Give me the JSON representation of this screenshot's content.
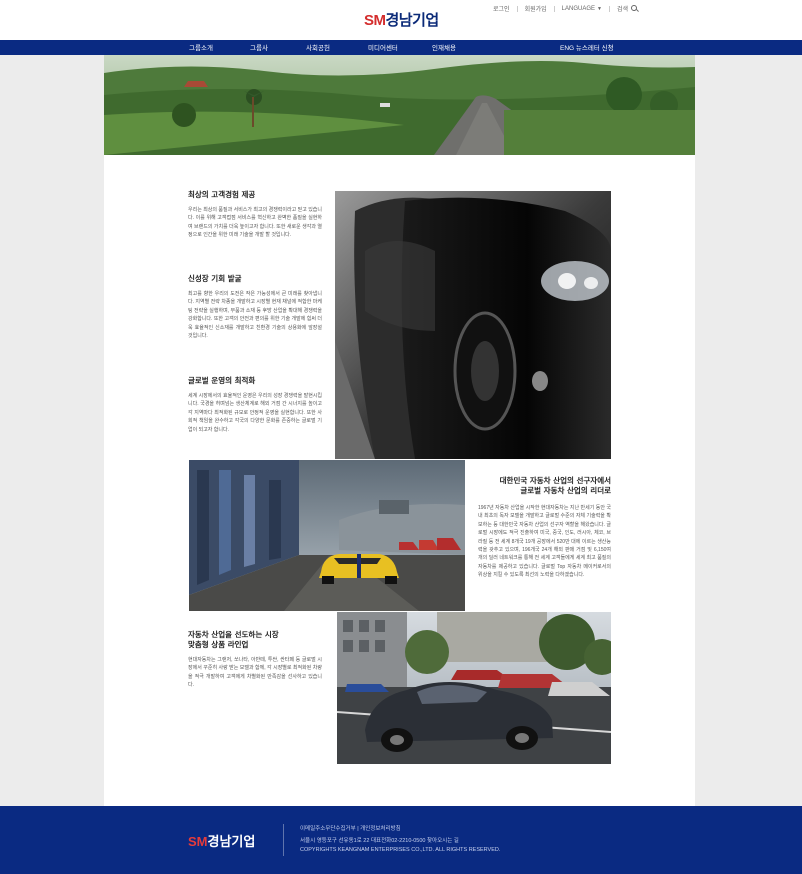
{
  "header": {
    "logo_sm": "SM",
    "logo_name": "경남기업",
    "util": {
      "login": "로그인",
      "join": "회원가입",
      "language": "LANGUAGE",
      "search": "검색"
    }
  },
  "nav": {
    "items": [
      "그룹소개",
      "그룹사",
      "사회공헌",
      "미디어센터",
      "인재채용"
    ],
    "right": "ENG  뉴스레터 신청"
  },
  "sections": [
    {
      "title": "최상의 고객경험 제공",
      "body": "우리는 최상의 품질과 서비스가 최고의 경쟁력이라고 믿고 있습니다. 이를 위해 고객접점 서비스를 혁신하고 완벽한 품질을 실현하여 브랜드의 가치를 더욱 높이고자 합니다. 또한 새로운 생각과 열정으로 인간을 위한 미래 기술을 개발 할 것입니다."
    },
    {
      "title": "신성장 기회 발굴",
      "body": "최고를 향한 우리의 도전은 작은 가능성에서 큰 미래를 찾아냅니다. 지역별 전략 차종을 개발하고 시장별 현재 채널에 적합한 마케팅 전략을 실행하며, 부품과 소재 등 후방 산업을 확대해 경쟁력을 강화합니다. 또한 고객의 안전과 편의를 위한 기술 개발에 힘써 더욱 효율적인 신소재를 개발하고 친환경 기술의 상용화에 앞장설 것입니다."
    },
    {
      "title": "글로벌 운영의 최적화",
      "body": "세계 시장에서의 효율적인 운영은 우리의 성장 경쟁력을 발현시킵니다. 국경을 허며넘는 생산체계로 해외 거점 간 시너지를 높이고 각 지역마다 최적화된 규모로 안정적 운영을 실현합니다. 또한 사회적 책임을 완수하고 각국의 다양한 문화를 존중하는 글로벌 기업이 되고자 합니다."
    },
    {
      "title_line1": "대한민국 자동차 산업의 선구자에서",
      "title_line2": "글로벌 자동차 산업의 리더로",
      "body": "1967년 자동차 산업을 시작한 현대자동차는 지난 반세기 동안 국내 최초의 독자 모델을 개발하고 글로벌 수준의 자체 기술력을 확보하는 등 대한민국 자동차 산업의 선구자 역할을 해왔습니다. 글로벌 시장에도 적극 진출하여 미국, 중국, 인도, 러시아, 체코, 브라질 등 전 세계 8개국 19개 공장에서 520만 대에 이르는 생산능력을 갖추고 있으며, 196개국 24개 해외 판매 거점 및 6,150여 개의 딜러 네트워크를 통해 전 세계 고객들에게 세계 최고 품질의 자동차를 제공하고 있습니다. 글로벌 Top 자동차 메이커로서의 위상을 지킬 수 있도록 최선의 노력을 다하겠습니다."
    },
    {
      "title_line1": "자동차 산업을 선도하는 시장",
      "title_line2": "맞춤형 상품 라인업",
      "body": "현대자동차는 그랜저, 쏘나타, 아반떼, 투싼, 싼타페 등 글로벌 시장에서 꾸준히 사랑 받는 모델과 함께, 각 시장별로 최적화된 차량을 적극 개발하여 고객에게 차별화된 만족감을 선사하고 있습니다."
    }
  ],
  "footer": {
    "logo_sm": "SM",
    "logo_name": "경남기업",
    "links": "이메일주소무단수집거부 | 개인정보처리방침",
    "address": "서울시 영등포구 선유동1로 22     대표전화02-2210-0500  찾아오시는 길",
    "copyright": "COPYRIGHTS KEANGNAM  ENTERPRISES CO.,LTD. ALL  RIGHTS RESERVED."
  },
  "colors": {
    "navy": "#0a2a82",
    "logo_red": "#d42d2d",
    "page_bg": "#ececec"
  }
}
